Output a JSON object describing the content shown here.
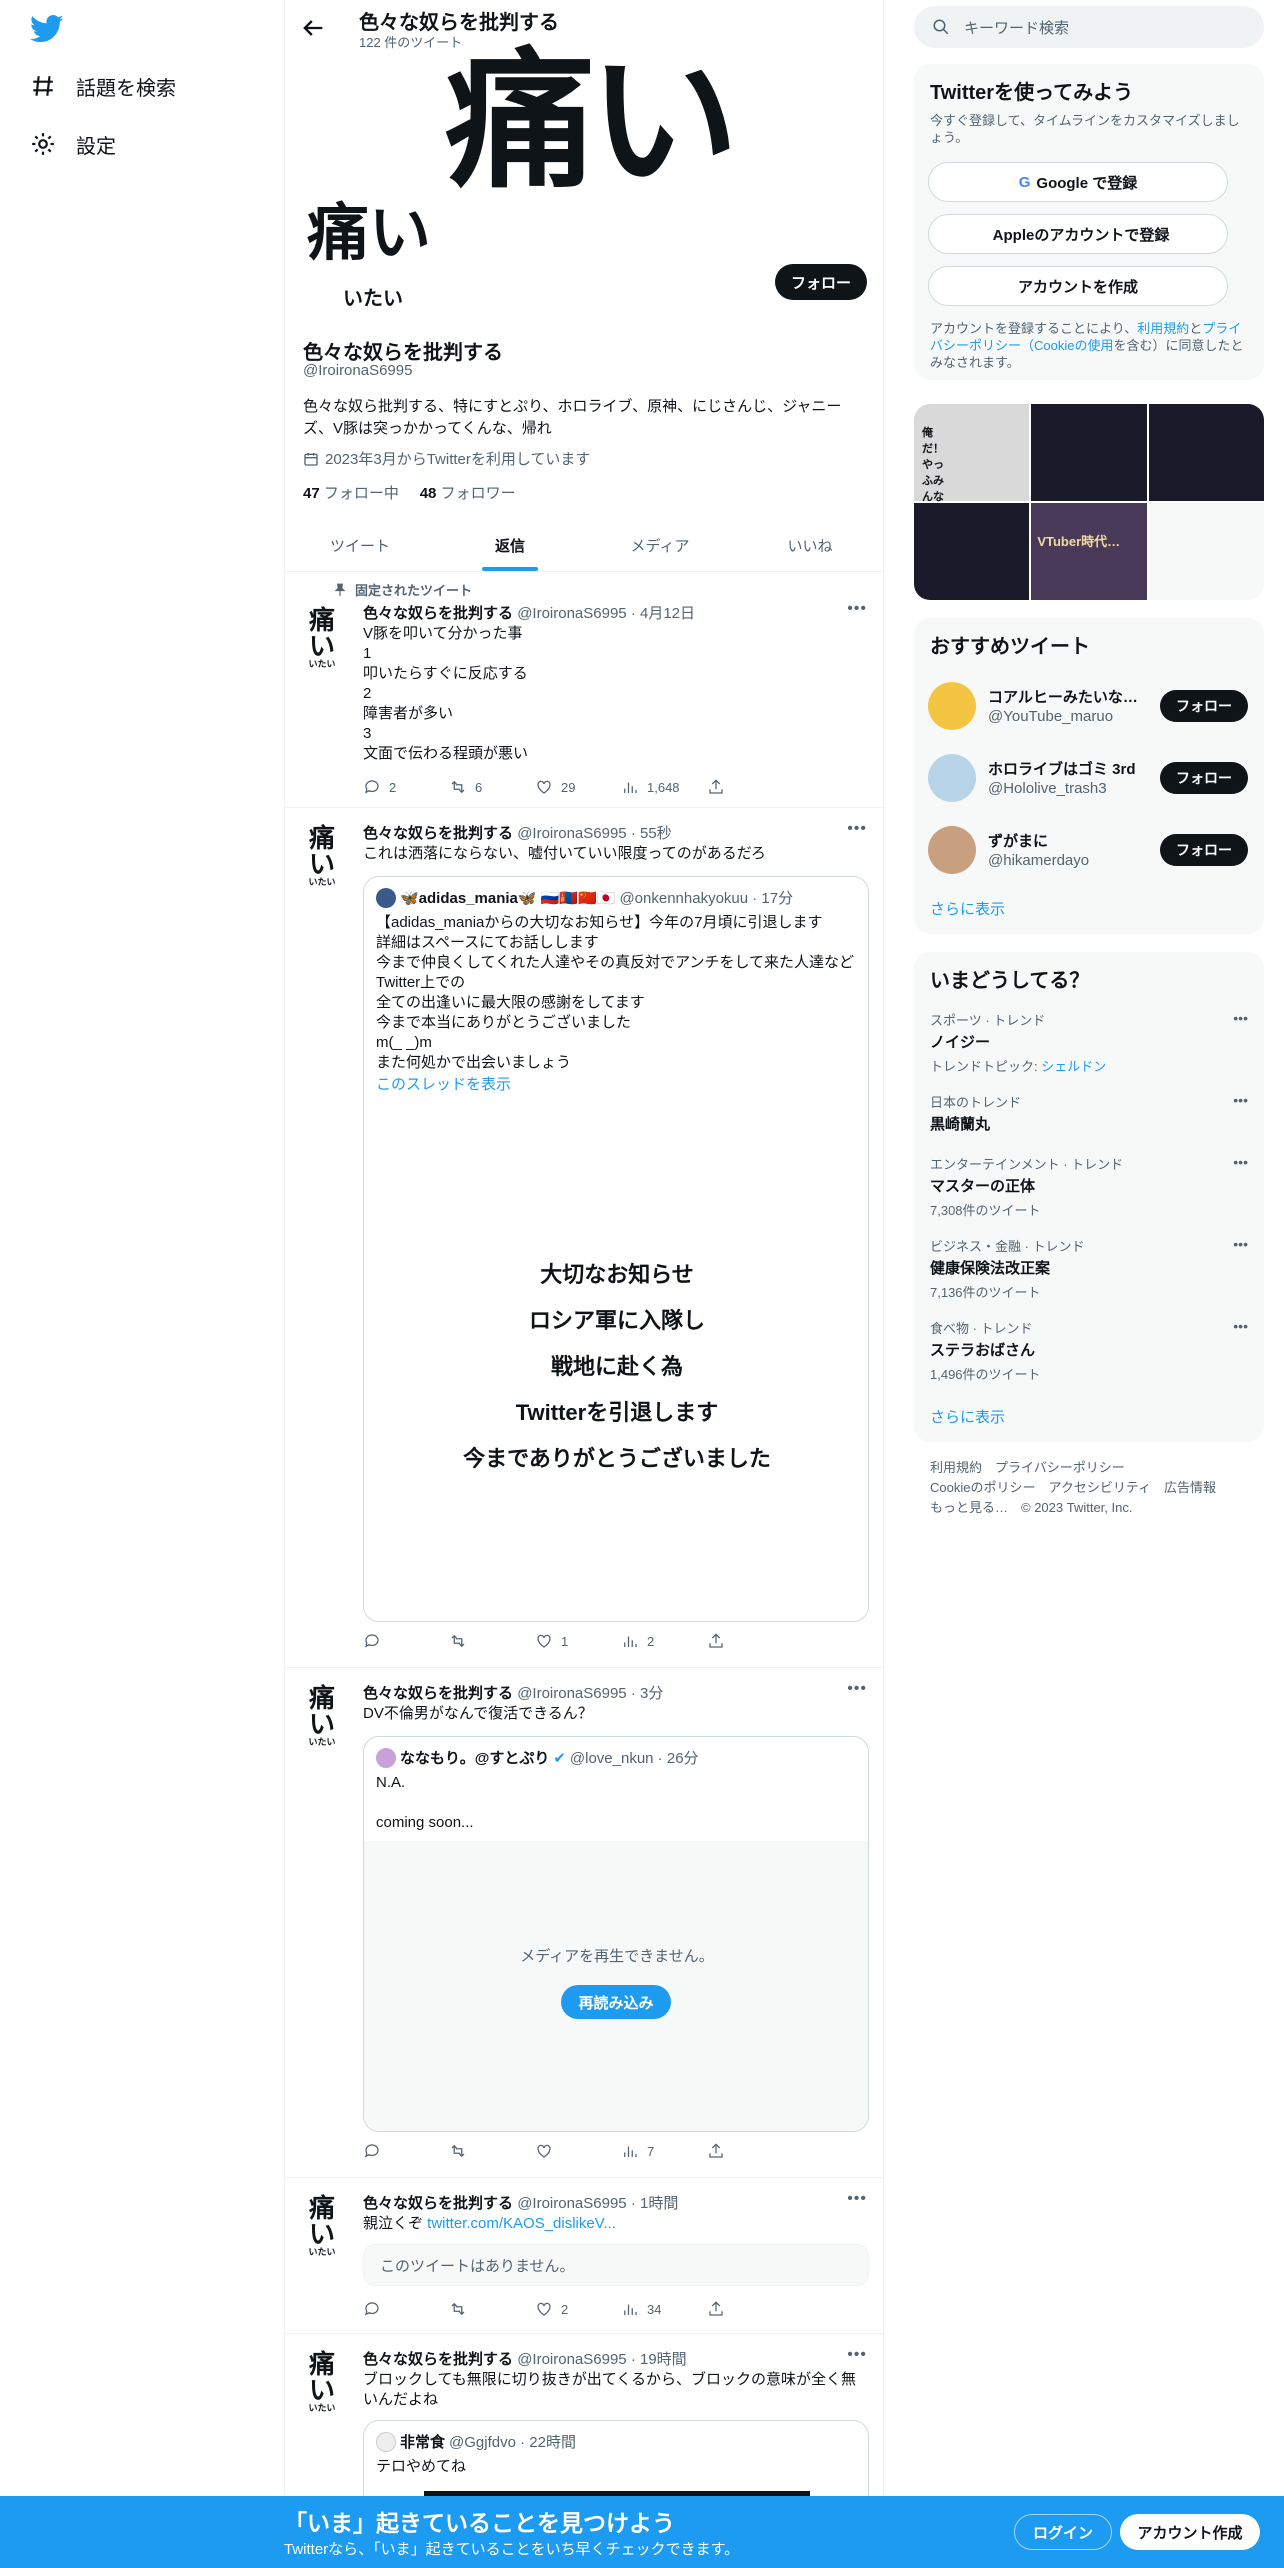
{
  "nav": {
    "explore": "話題を検索",
    "settings": "設定"
  },
  "header": {
    "title": "色々な奴らを批判する",
    "subtitle": "122 件のツイート"
  },
  "banner": {
    "big": "痛い",
    "small": "痛い",
    "ruby": "いたい"
  },
  "profile": {
    "follow_label": "フォロー",
    "name": "色々な奴らを批判する",
    "handle": "@IroironaS6995",
    "bio": "色々な奴ら批判する、特にすとぷり、ホロライブ、原神、にじさんじ、ジャニーズ、V豚は突っかかってくんな、帰れ",
    "joined": "2023年3月からTwitterを利用しています",
    "following_count": "47",
    "following_label": "フォロー中",
    "followers_count": "48",
    "followers_label": "フォロワー"
  },
  "tabs": [
    "ツイート",
    "返信",
    "メディア",
    "いいね"
  ],
  "avatar": {
    "big": "痛い",
    "small": "いたい"
  },
  "tweets": [
    {
      "pinned": "固定されたツイート",
      "name": "色々な奴らを批判する",
      "meta": "@IroironaS6995 · 4月12日",
      "text": "V豚を叩いて分かった事\n1\n叩いたらすぐに反応する\n2\n障害者が多い\n3\n文面で伝わる程頭が悪い",
      "replies": "2",
      "retweets": "6",
      "likes": "29",
      "views": "1,648"
    },
    {
      "name": "色々な奴らを批判する",
      "meta": "@IroironaS6995 · 55秒",
      "text": "これは洒落にならない、嘘付いていい限度ってのがあるだろ",
      "quote": {
        "name": "🦋adidas_mania🦋 🇷🇺🇲🇳🇨🇳🇯🇵",
        "meta": "@onkennhakyokuu · 17分",
        "text": "【adidas_maniaからの大切なお知らせ】今年の7月頃に引退します\n詳細はスペースにてお話しします\n今まで仲良くしてくれた人達やその真反対でアンチをして来た人達など\nTwitter上での\n全ての出逢いに最大限の感謝をしてます\n今まで本当にありがとうございました\nm(_ _)m\nまた何処かで出会いましょう",
        "thread": "このスレッドを表示",
        "image_lines": [
          "大切なお知らせ",
          "ロシア軍に入隊し",
          "戦地に赴く為",
          "Twitterを引退します",
          "今までありがとうございました"
        ]
      },
      "replies": "",
      "retweets": "",
      "likes": "1",
      "views": "2"
    },
    {
      "name": "色々な奴らを批判する",
      "meta": "@IroironaS6995 · 3分",
      "text": "DV不倫男がなんで復活できるん？",
      "quote": {
        "name": "ななもり。@すとぷり",
        "meta": "@love_nkun · 26分",
        "text": "N.A.\n\ncoming soon...",
        "media_error": "メディアを再生できません。",
        "reload": "再読み込み"
      },
      "replies": "",
      "retweets": "",
      "likes": "",
      "views": "7"
    },
    {
      "name": "色々な奴らを批判する",
      "meta": "@IroironaS6995 · 1時間",
      "text_prefix": "親泣くぞ ",
      "link": "twitter.com/KAOS_dislikeV...",
      "unavailable": "このツイートはありません。",
      "replies": "",
      "retweets": "",
      "likes": "2",
      "views": "34"
    },
    {
      "name": "色々な奴らを批判する",
      "meta": "@IroironaS6995 · 19時間",
      "text": "ブロックしても無限に切り抜きが出てくるから、ブロックの意味が全く無いんだよね",
      "quote": {
        "name": "非常食",
        "meta": "@Ggjfdvo · 22時間",
        "text": "テロやめてね"
      }
    }
  ],
  "right": {
    "search_placeholder": "キーワード検索",
    "signup": {
      "title": "Twitterを使ってみよう",
      "sub": "今すぐ登録して、タイムラインをカスタマイズしましょう。",
      "google": "Google で登録",
      "apple": "Appleのアカウントで登録",
      "create": "アカウントを作成",
      "terms_a": "アカウントを登録することにより、",
      "terms_link1": "利用規約",
      "terms_b": "と",
      "terms_link2": "プライバシーポリシー（Cookieの使用",
      "terms_c": "を含む）に同意したとみなされます。"
    },
    "grid_labels": [
      "俺だ！やっふみんな",
      "VTuber時代…"
    ],
    "recommended": {
      "title": "おすすめツイート",
      "items": [
        {
          "name": "コアルヒーみたいな…",
          "handle": "@YouTube_maruo",
          "btn": "フォロー"
        },
        {
          "name": "ホロライブはゴミ 3rd",
          "handle": "@Hololive_trash3",
          "btn": "フォロー"
        },
        {
          "name": "ずがまに",
          "handle": "@hikamerdayo",
          "btn": "フォロー"
        }
      ],
      "more": "さらに表示"
    },
    "trends": {
      "title": "いまどうしてる？",
      "items": [
        {
          "cat": "スポーツ · トレンド",
          "name": "ノイジー",
          "sub_a": "トレンドトピック: ",
          "sub_link": "シェルドン"
        },
        {
          "cat": "日本のトレンド",
          "name": "黒崎蘭丸",
          "sub": ""
        },
        {
          "cat": "エンターテインメント · トレンド",
          "name": "マスターの正体",
          "sub": "7,308件のツイート"
        },
        {
          "cat": "ビジネス・金融 · トレンド",
          "name": "健康保険法改正案",
          "sub": "7,136件のツイート"
        },
        {
          "cat": "食べ物 · トレンド",
          "name": "ステラおばさん",
          "sub": "1,496件のツイート"
        }
      ],
      "more": "さらに表示"
    },
    "footer": {
      "l1": "利用規約　プライバシーポリシー",
      "l2": "Cookieのポリシー　アクセシビリティ　広告情報",
      "l3": "もっと見る…　© 2023 Twitter, Inc."
    }
  },
  "bottombar": {
    "title": "「いま」起きていることを見つけよう",
    "sub": "Twitterなら、「いま」起きていることをいち早くチェックできます。",
    "login": "ログイン",
    "signup": "アカウント作成"
  },
  "colors": {
    "accent": "#1d9bf0",
    "text": "#0f1419",
    "muted": "#536471"
  }
}
